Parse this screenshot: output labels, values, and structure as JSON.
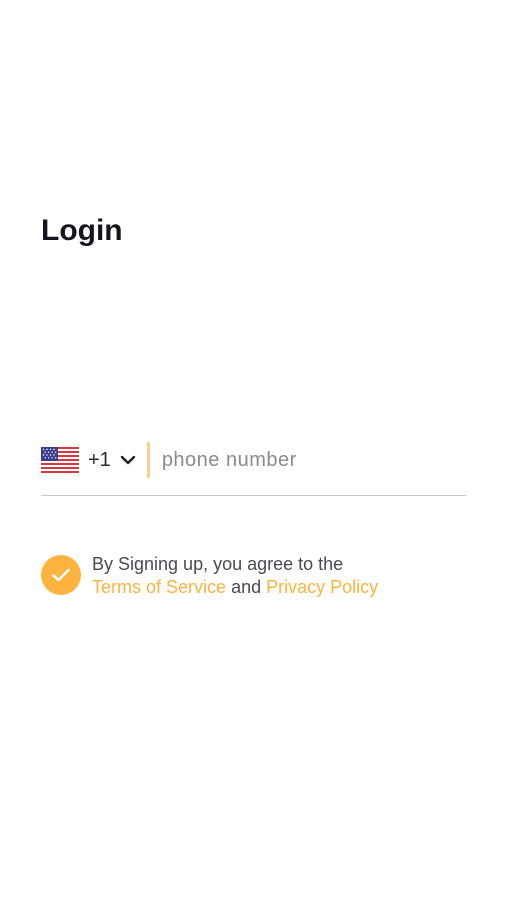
{
  "login": {
    "title": "Login"
  },
  "phone": {
    "country_icon": "us-flag-icon",
    "dial_code": "+1",
    "placeholder": "phone number",
    "value": ""
  },
  "consent": {
    "checked": true,
    "line1": "By Signing up, you agree to the",
    "terms_link": "Terms of Service",
    "and_text": "and",
    "privacy_link": "Privacy Policy"
  },
  "colors": {
    "accent": "#fdb33f",
    "title": "#15151f",
    "divider": "#fbd089"
  }
}
